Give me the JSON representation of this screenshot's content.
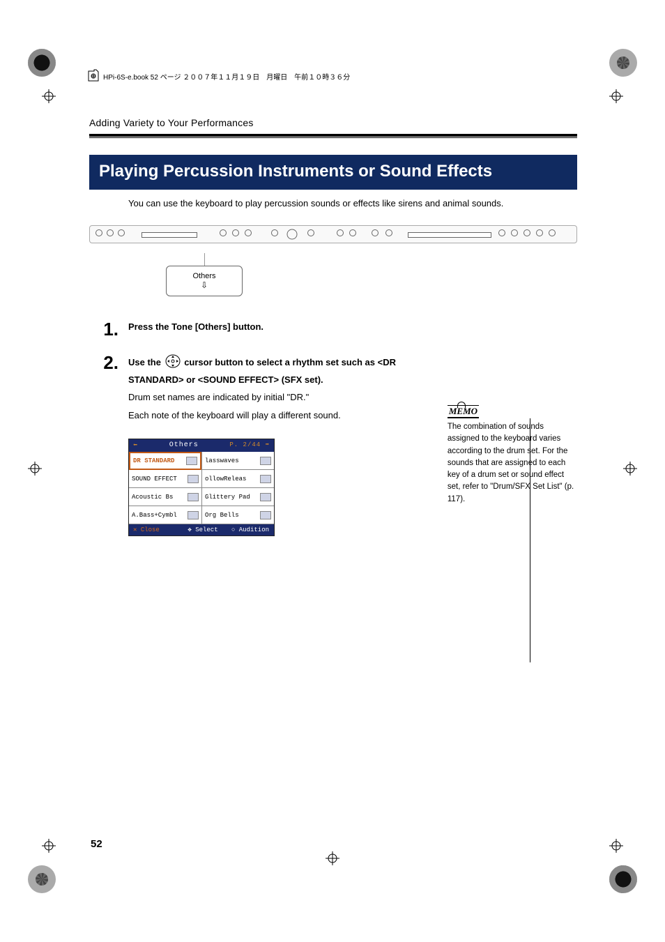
{
  "header": {
    "file_info": "HPi-6S-e.book  52 ページ  ２００７年１１月１９日　月曜日　午前１０時３６分"
  },
  "running_head": "Adding Variety to Your Performances",
  "section_title": "Playing Percussion Instruments or Sound Effects",
  "intro": "You can use the keyboard to play percussion sounds or effects like sirens and animal sounds.",
  "callout": {
    "label": "Others",
    "arrow": "⇩"
  },
  "steps": [
    {
      "num": "1.",
      "head": "Press the Tone [Others] button."
    },
    {
      "num": "2.",
      "head_pre": "Use the ",
      "head_post": " cursor button to select a rhythm set such as <DR STANDARD> or <SOUND EFFECT> (SFX set).",
      "sub1": "Drum set names are indicated by initial \"DR.\"",
      "sub2": "Each note of the keyboard will play a different sound."
    }
  ],
  "screen": {
    "back_arrow": "⬅",
    "title": "Others",
    "page_ind": "P. 2/44 ➡",
    "cells": [
      [
        "DR STANDARD",
        "lasswaves"
      ],
      [
        "SOUND EFFECT",
        "ollowReleas"
      ],
      [
        "Acoustic Bs",
        "Glittery Pad"
      ],
      [
        "A.Bass+Cymbl",
        "Org Bells"
      ]
    ],
    "footer": {
      "close": "✕ Close",
      "select": "✥ Select",
      "audition": "○ Audition"
    }
  },
  "memo": {
    "label": "MEMO",
    "text": "The combination of sounds assigned to the keyboard varies according to the drum set. For the sounds that are assigned to each key of a drum set or sound effect set, refer to \"Drum/SFX Set List\" (p. 117)."
  },
  "page_number": "52"
}
